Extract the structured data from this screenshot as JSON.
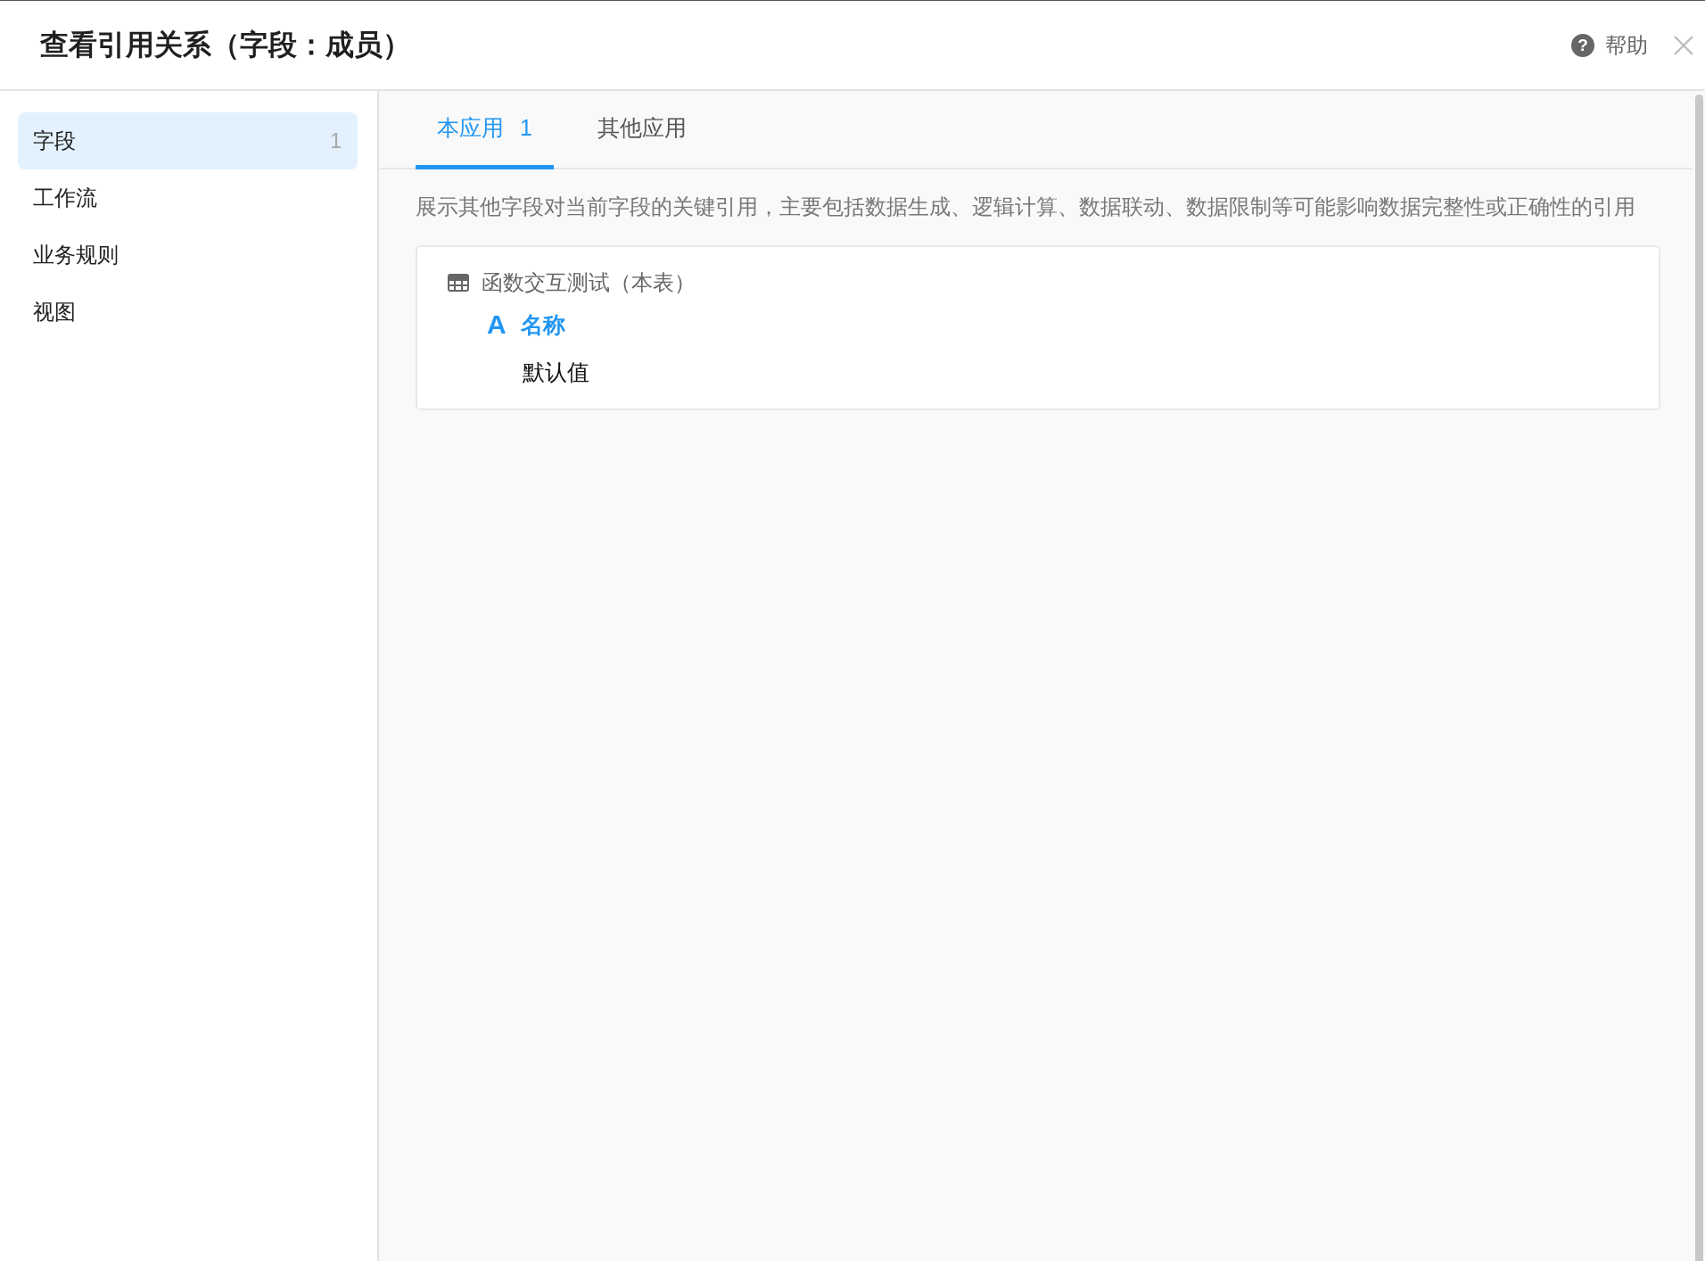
{
  "window": {
    "title": "查看引用关系（字段：成员）"
  },
  "help": {
    "icon_glyph": "?",
    "label": "帮助"
  },
  "sidebar": {
    "items": [
      {
        "label": "字段",
        "count": "1",
        "selected": true
      },
      {
        "label": "工作流",
        "selected": false
      },
      {
        "label": "业务规则",
        "selected": false
      },
      {
        "label": "视图",
        "selected": false
      }
    ]
  },
  "tabs": [
    {
      "label": "本应用",
      "count": "1",
      "selected": true
    },
    {
      "label": "其他应用",
      "selected": false
    }
  ],
  "description": "展示其他字段对当前字段的关键引用，主要包括数据生成、逻辑计算、数据联动、数据限制等可能影响数据完整性或正确性的引用",
  "references": [
    {
      "table": "函数交互测试（本表）",
      "fields": [
        {
          "type_glyph": "A",
          "name": "名称",
          "usages": [
            "默认值"
          ]
        }
      ]
    }
  ]
}
